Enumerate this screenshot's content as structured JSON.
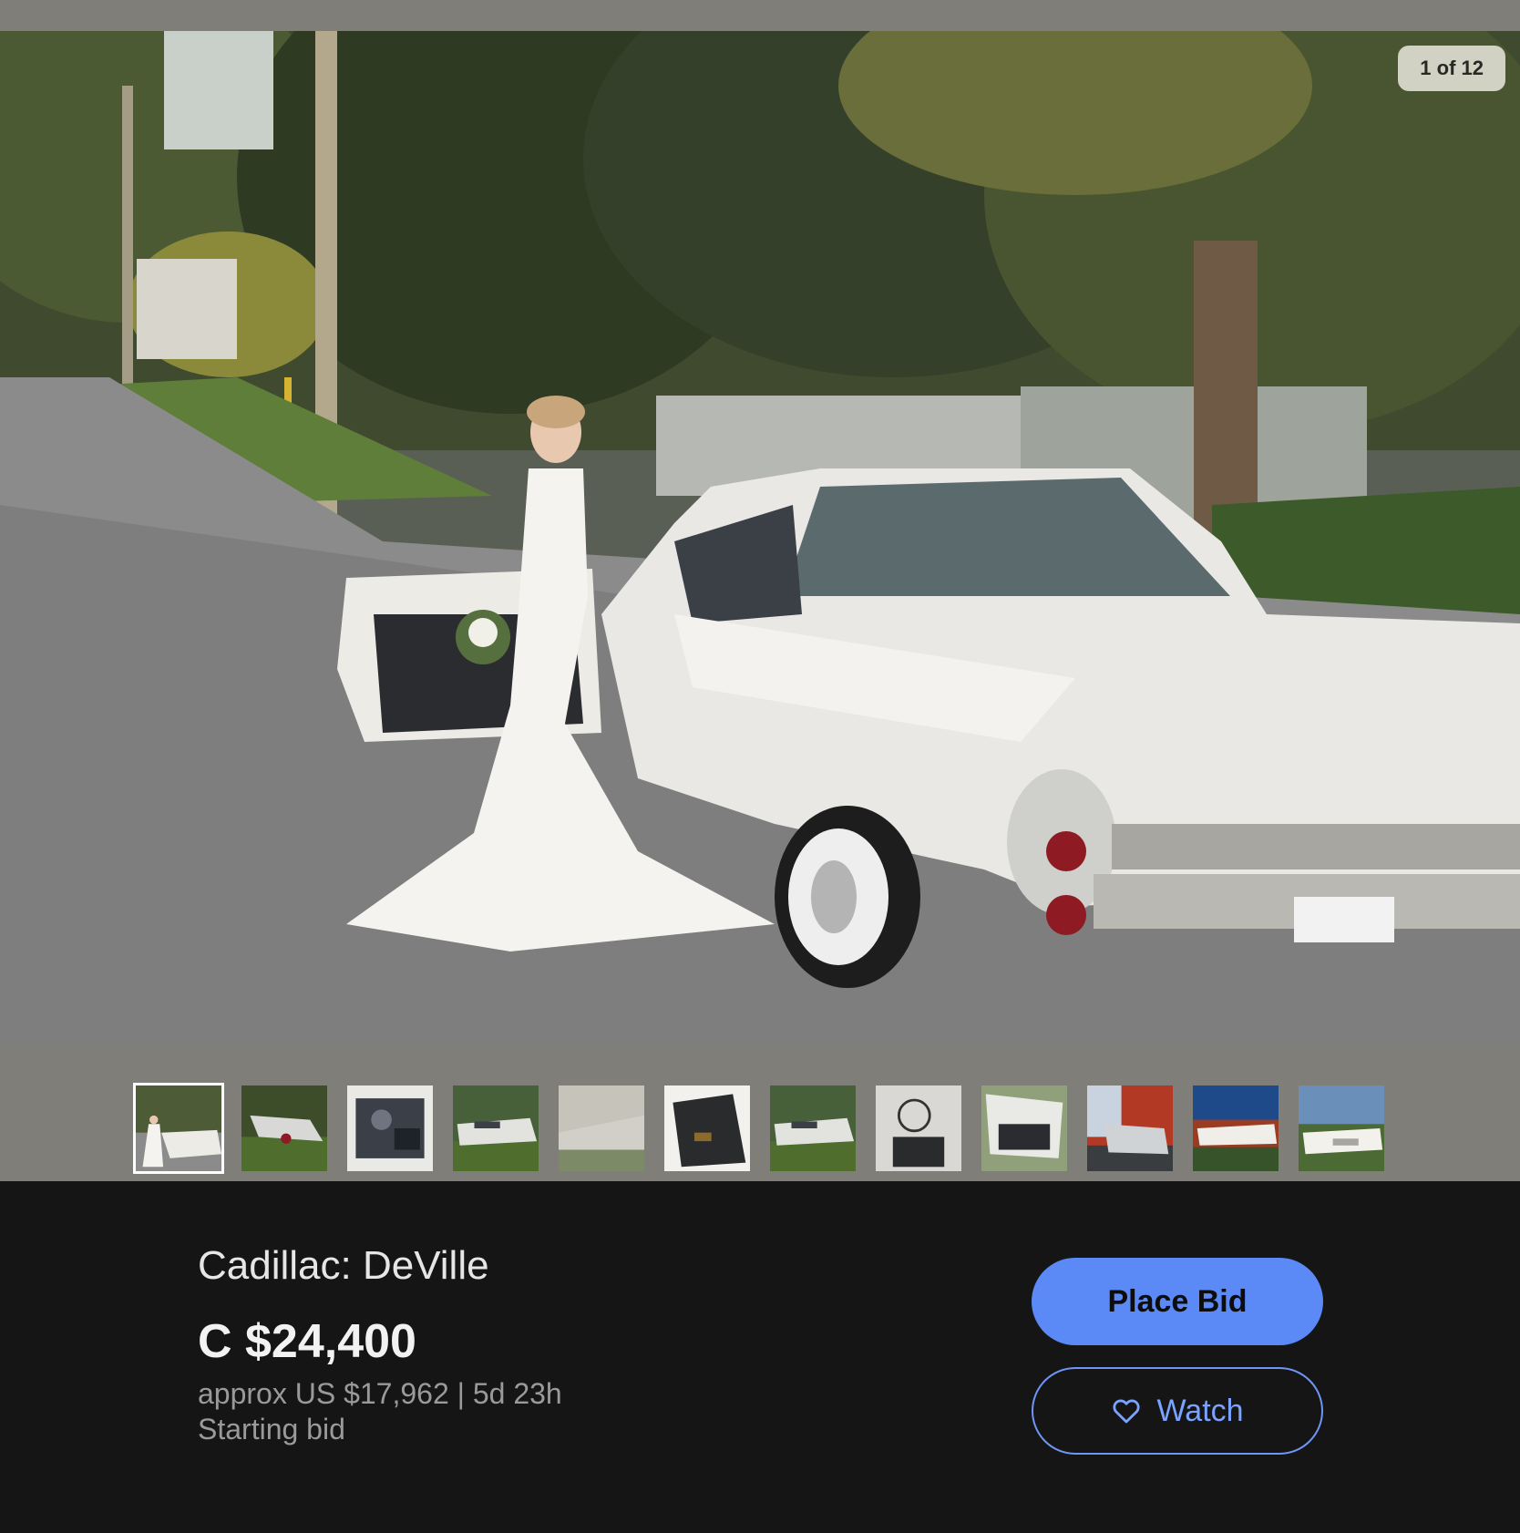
{
  "gallery": {
    "counter": "1 of 12",
    "main_image_alt": "Bride standing beside white classic Cadillac DeVille",
    "thumbnails": [
      {
        "name": "thumb-1",
        "scene": "bride",
        "selected": true
      },
      {
        "name": "thumb-2",
        "scene": "rear"
      },
      {
        "name": "thumb-3",
        "scene": "engine"
      },
      {
        "name": "thumb-4",
        "scene": "side"
      },
      {
        "name": "thumb-5",
        "scene": "roof"
      },
      {
        "name": "thumb-6",
        "scene": "floor"
      },
      {
        "name": "thumb-7",
        "scene": "side"
      },
      {
        "name": "thumb-8",
        "scene": "interior"
      },
      {
        "name": "thumb-9",
        "scene": "door"
      },
      {
        "name": "thumb-10",
        "scene": "autumn-rear"
      },
      {
        "name": "thumb-11",
        "scene": "autumn-side"
      },
      {
        "name": "thumb-12",
        "scene": "front"
      }
    ]
  },
  "listing": {
    "title": "Cadillac: DeVille",
    "price": "C $24,400",
    "approx": "approx US $17,962 | 5d 23h",
    "bid_type": "Starting bid"
  },
  "actions": {
    "place_bid_label": "Place Bid",
    "watch_label": "Watch"
  },
  "colors": {
    "accent": "#5b8af7",
    "background": "#151515",
    "gallery_bg": "#7f7e79"
  }
}
